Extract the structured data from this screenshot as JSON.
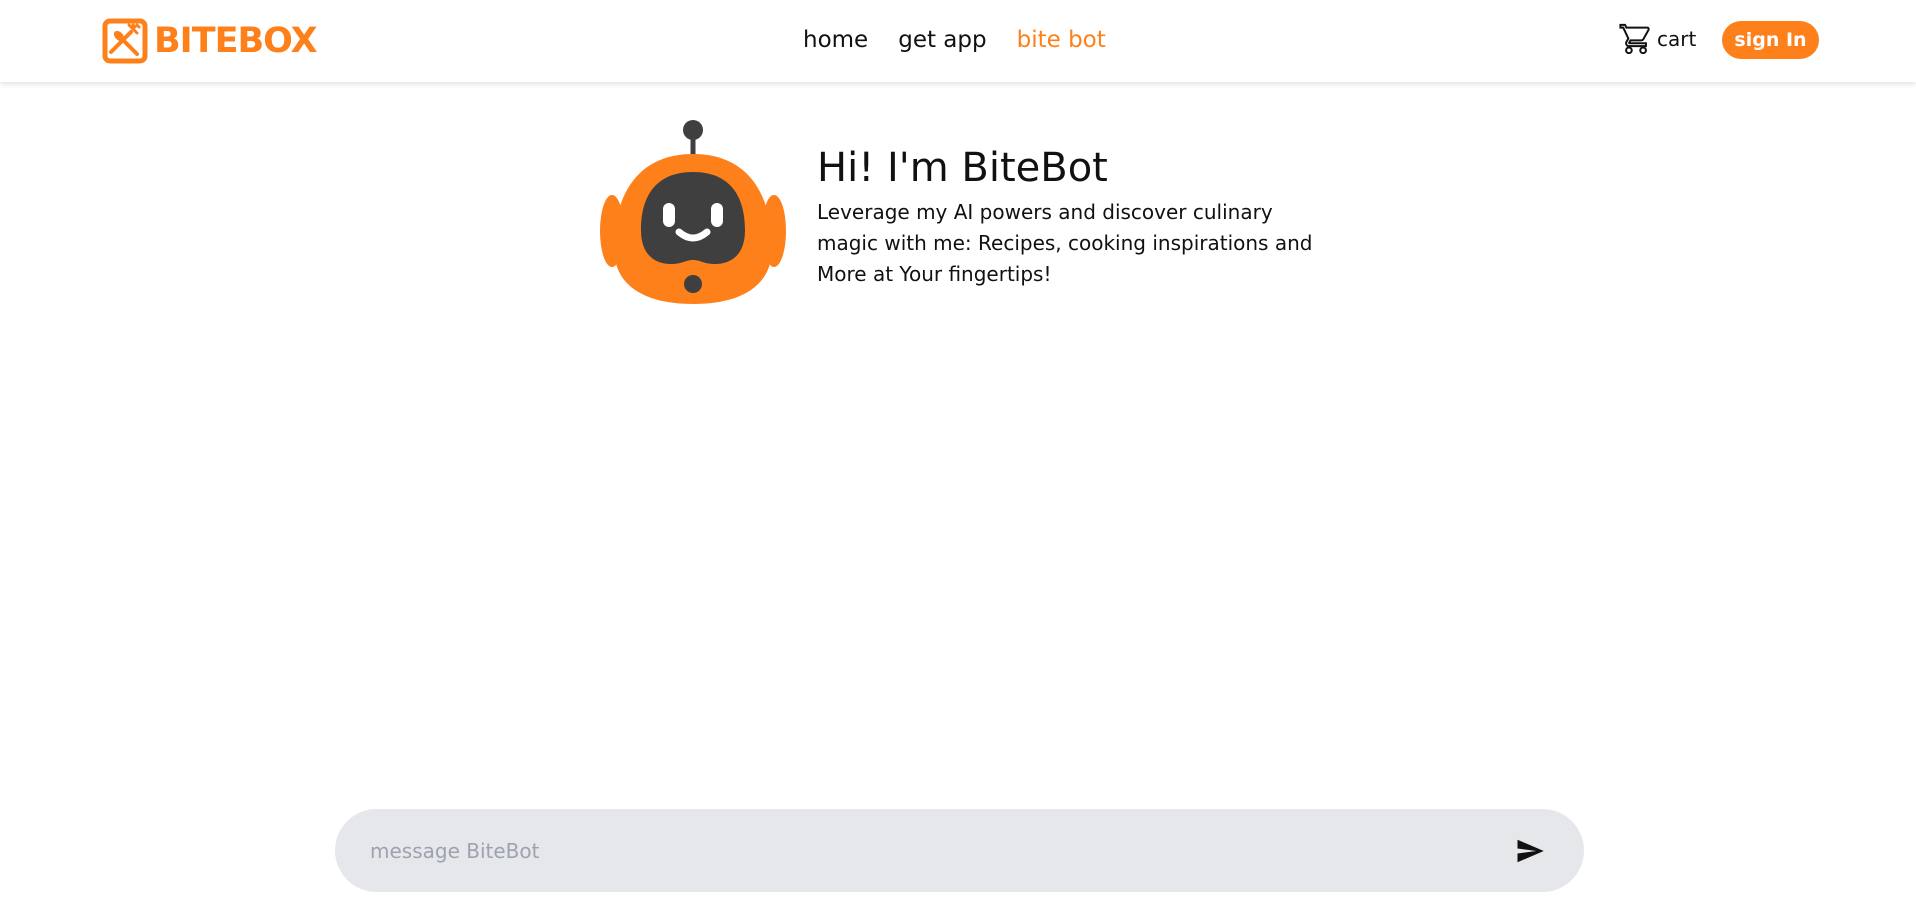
{
  "brand": {
    "name": "BITEBOX",
    "logo_icon": "plate-cutlery-icon"
  },
  "nav": {
    "items": [
      {
        "label": "home",
        "active": false
      },
      {
        "label": "get app",
        "active": false
      },
      {
        "label": "bite bot",
        "active": true
      }
    ]
  },
  "cart": {
    "label": "cart",
    "icon": "cart-icon"
  },
  "auth": {
    "signin_label": "sign In"
  },
  "intro": {
    "avatar_icon": "robot-icon",
    "title": "Hi! I'm BiteBot",
    "description": "Leverage my AI powers and discover culinary magic with me: Recipes, cooking inspirations and More at Your fingertips!"
  },
  "composer": {
    "placeholder": "message BiteBot",
    "value": "",
    "send_icon": "send-icon"
  },
  "colors": {
    "accent": "#fe801b",
    "text": "#111111",
    "robot_face": "#3f3f3f",
    "input_bg": "#e5e7eb",
    "placeholder": "#9ca3af"
  }
}
